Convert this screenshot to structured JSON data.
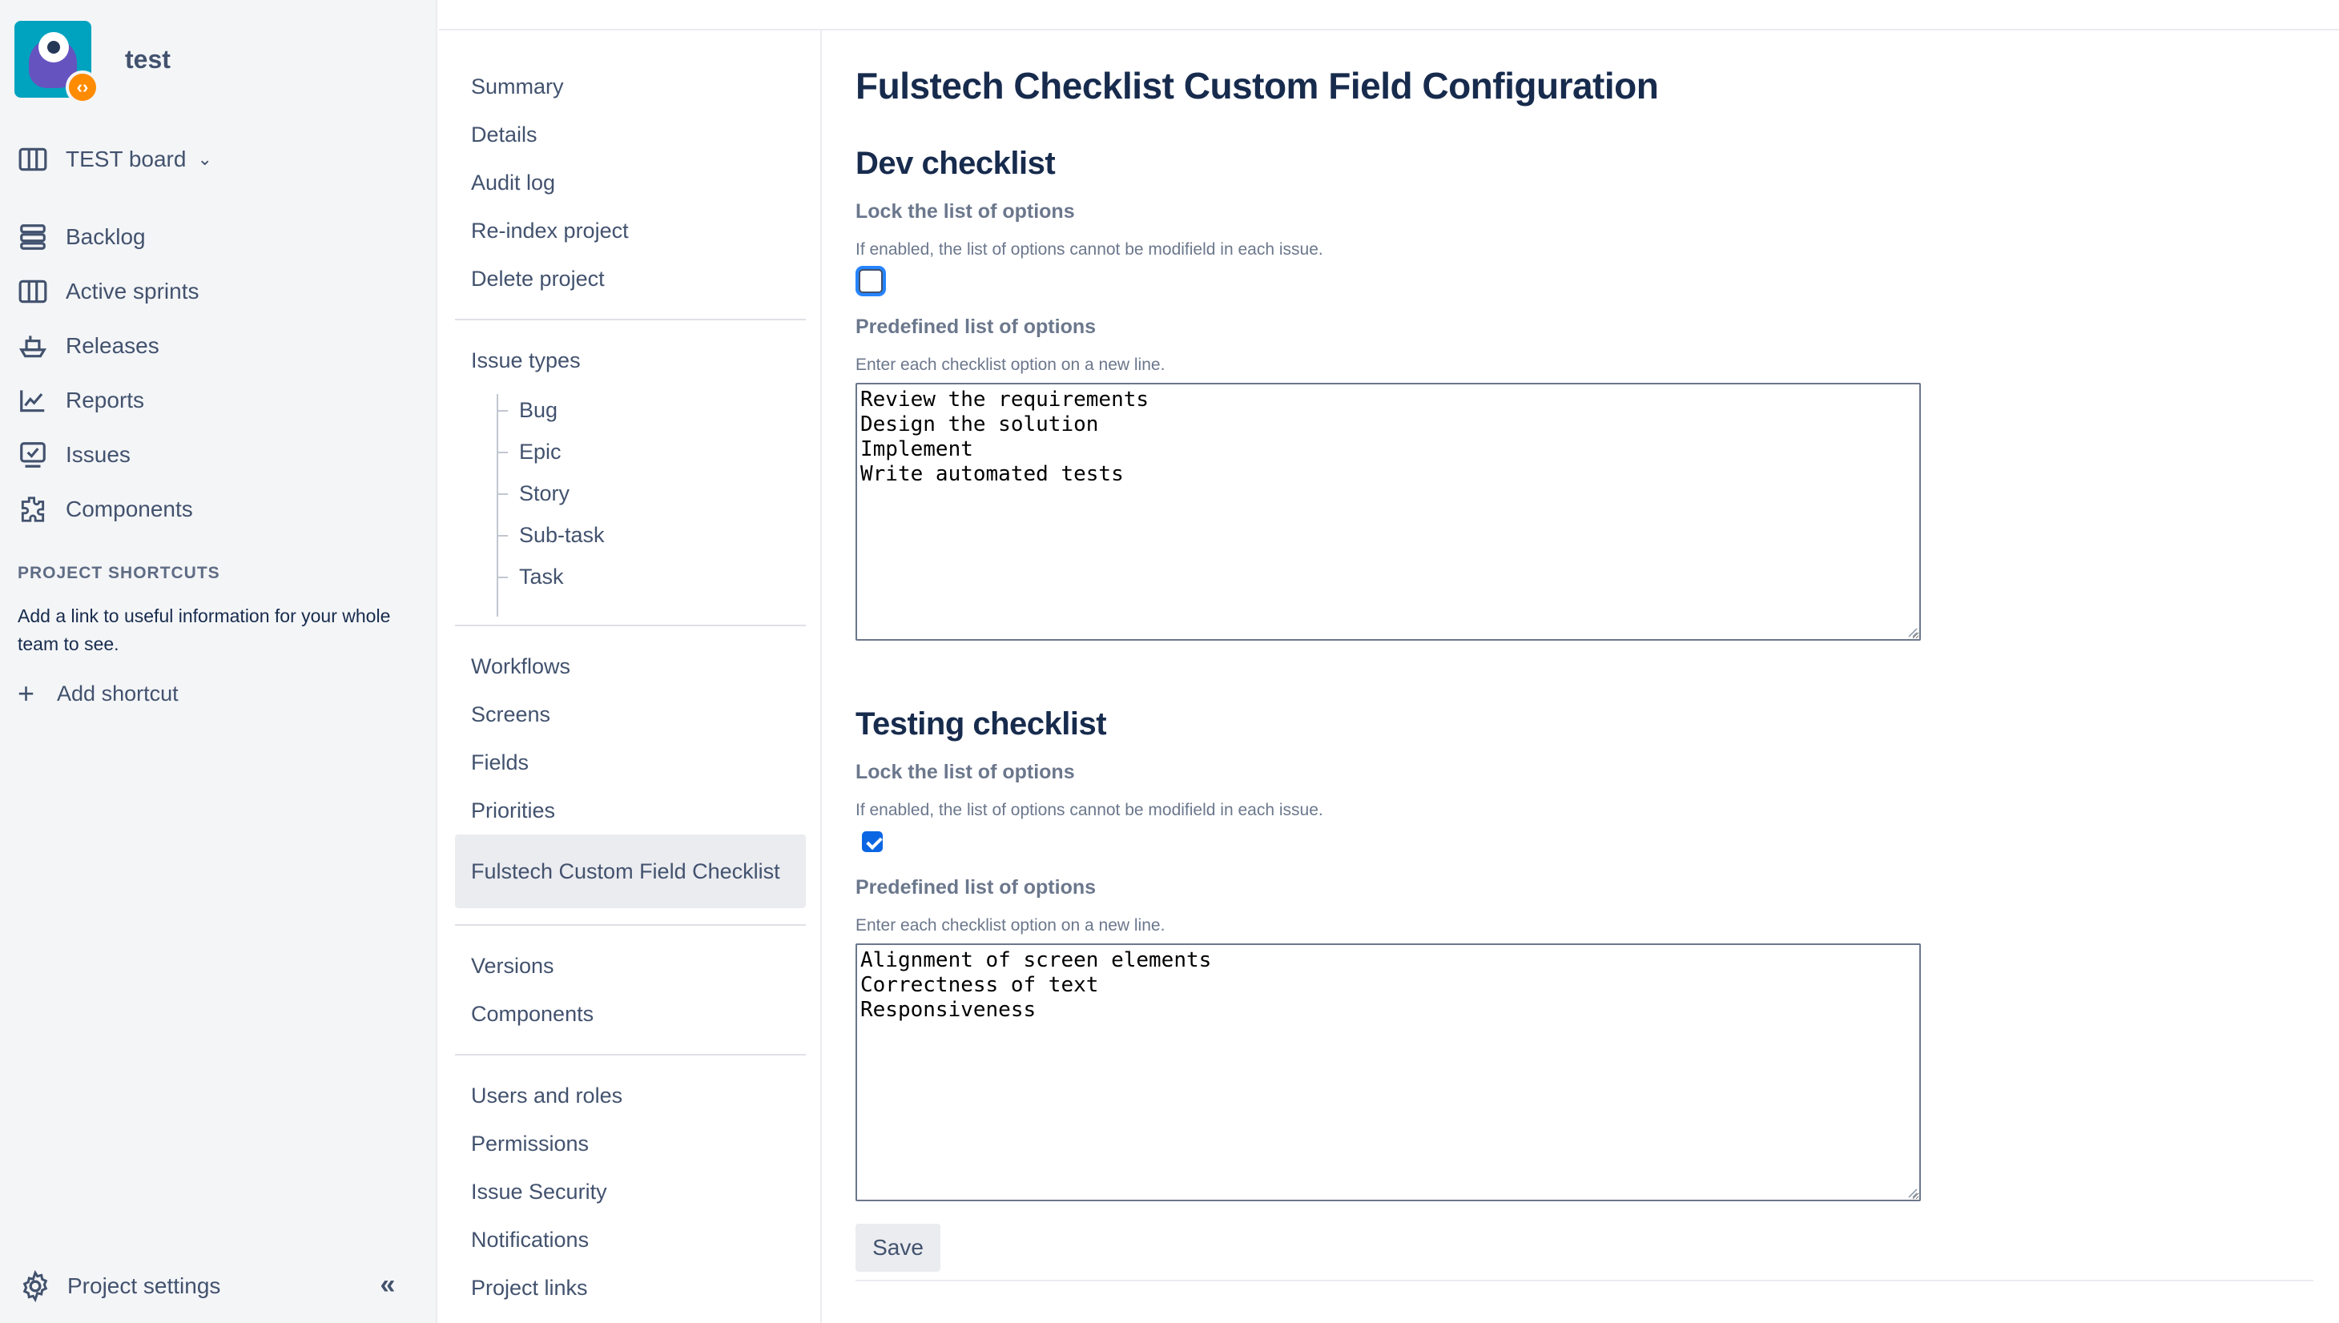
{
  "project": {
    "name": "test",
    "badge_glyph": "‹›"
  },
  "board": {
    "label": "TEST board"
  },
  "nav": {
    "items": [
      {
        "label": "Backlog",
        "icon": "backlog-icon"
      },
      {
        "label": "Active sprints",
        "icon": "board-icon"
      },
      {
        "label": "Releases",
        "icon": "ship-icon"
      },
      {
        "label": "Reports",
        "icon": "chart-icon"
      },
      {
        "label": "Issues",
        "icon": "issues-icon"
      },
      {
        "label": "Components",
        "icon": "puzzle-icon"
      }
    ]
  },
  "shortcuts": {
    "heading": "PROJECT SHORTCUTS",
    "description": "Add a link to useful information for your whole team to see.",
    "add_label": "Add shortcut"
  },
  "footer": {
    "settings_label": "Project settings",
    "collapse_glyph": "«"
  },
  "subnav": {
    "group1": [
      "Summary",
      "Details",
      "Audit log",
      "Re-index project",
      "Delete project"
    ],
    "issue_types_label": "Issue types",
    "issue_types": [
      "Bug",
      "Epic",
      "Story",
      "Sub-task",
      "Task"
    ],
    "group3": [
      "Workflows",
      "Screens",
      "Fields",
      "Priorities"
    ],
    "active_item": "Fulstech Custom Field Checklist",
    "group4": [
      "Versions",
      "Components"
    ],
    "group5": [
      "Users and roles",
      "Permissions",
      "Issue Security",
      "Notifications",
      "Project links"
    ]
  },
  "main": {
    "title": "Fulstech Checklist Custom Field Configuration",
    "sections": [
      {
        "title": "Dev checklist",
        "lock_label": "Lock the list of options",
        "lock_help": "If enabled, the list of options cannot be modifield in each issue.",
        "locked": false,
        "options_label": "Predefined list of options",
        "options_help": "Enter each checklist option on a new line.",
        "options_value": "Review the requirements\nDesign the solution\nImplement\nWrite automated tests"
      },
      {
        "title": "Testing checklist",
        "lock_label": "Lock the list of options",
        "lock_help": "If enabled, the list of options cannot be modifield in each issue.",
        "locked": true,
        "options_label": "Predefined list of options",
        "options_help": "Enter each checklist option on a new line.",
        "options_value": "Alignment of screen elements\nCorrectness of text\nResponsiveness"
      }
    ],
    "save_label": "Save"
  },
  "colors": {
    "sidebar_bg": "#f4f5f7",
    "accent": "#0c66e4",
    "focus_ring": "#2684ff",
    "text_primary": "#172b4d",
    "text_secondary": "#42526e"
  }
}
